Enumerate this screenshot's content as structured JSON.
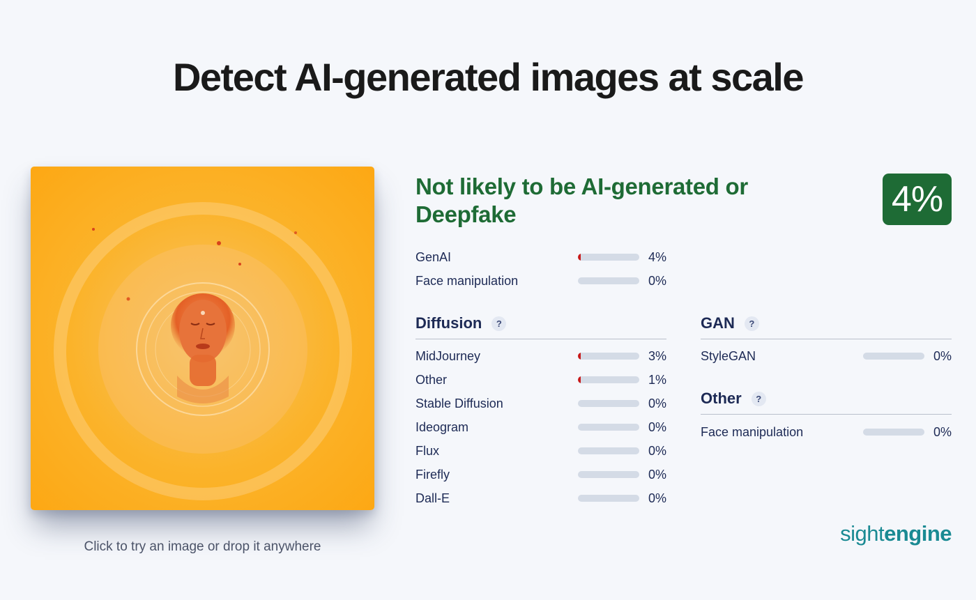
{
  "headline": "Detect AI-generated images at scale",
  "upload_hint": "Click to try an image or drop it anywhere",
  "verdict": {
    "text": "Not likely to be AI-generated or Deepfake",
    "score": "4%",
    "color": "#1e6b35"
  },
  "summary": [
    {
      "label": "GenAI",
      "value": "4%",
      "level": 0.04
    },
    {
      "label": "Face manipulation",
      "value": "0%",
      "level": 0.0
    }
  ],
  "diffusion": {
    "title": "Diffusion",
    "help": "?",
    "items": [
      {
        "label": "MidJourney",
        "value": "3%",
        "level": 0.03
      },
      {
        "label": "Other",
        "value": "1%",
        "level": 0.01
      },
      {
        "label": "Stable Diffusion",
        "value": "0%",
        "level": 0.0
      },
      {
        "label": "Ideogram",
        "value": "0%",
        "level": 0.0
      },
      {
        "label": "Flux",
        "value": "0%",
        "level": 0.0
      },
      {
        "label": "Firefly",
        "value": "0%",
        "level": 0.0
      },
      {
        "label": "Dall-E",
        "value": "0%",
        "level": 0.0
      }
    ]
  },
  "gan": {
    "title": "GAN",
    "help": "?",
    "items": [
      {
        "label": "StyleGAN",
        "value": "0%",
        "level": 0.0
      }
    ]
  },
  "other": {
    "title": "Other",
    "help": "?",
    "items": [
      {
        "label": "Face manipulation",
        "value": "0%",
        "level": 0.0
      }
    ]
  },
  "brand": {
    "part1": "sight",
    "part2": "engine"
  },
  "colors": {
    "accent_green": "#1e6b35",
    "bar_fill_red": "#c81a1a",
    "bar_track": "#d4dbe6",
    "brand_teal": "#1a8a93",
    "image_orange": "#f9a825"
  }
}
